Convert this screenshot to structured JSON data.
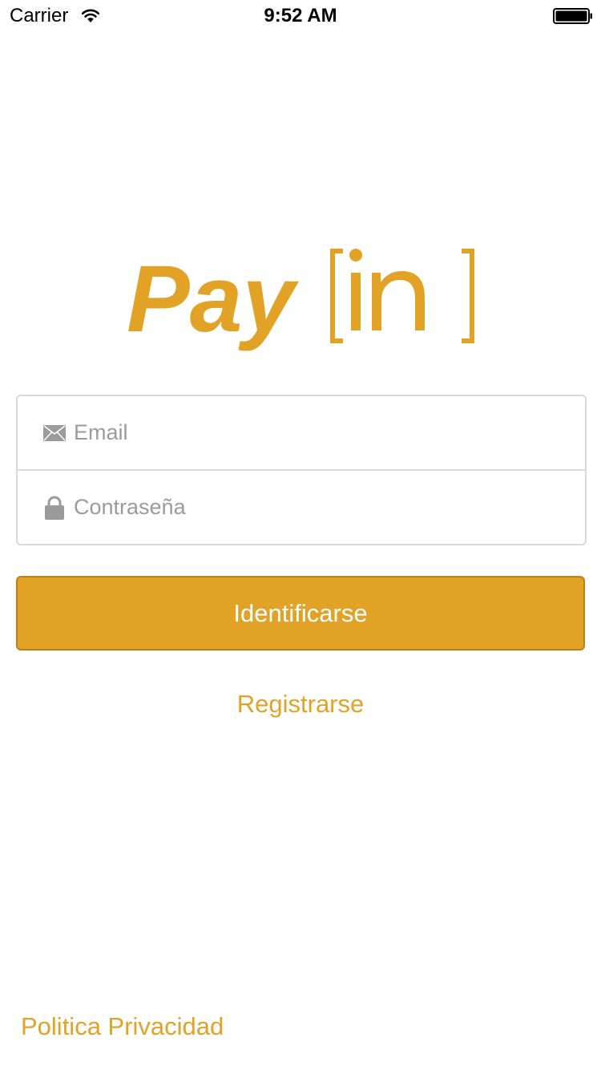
{
  "status_bar": {
    "carrier": "Carrier",
    "time": "9:52 AM"
  },
  "logo": {
    "text": "Pay[in]",
    "color": "#e2a226"
  },
  "login_form": {
    "email": {
      "placeholder": "Email",
      "value": "",
      "icon": "envelope-icon"
    },
    "password": {
      "placeholder": "Contraseña",
      "value": "",
      "icon": "lock-icon"
    }
  },
  "login_button": {
    "label": "Identificarse"
  },
  "register_link": {
    "label": "Registrarse"
  },
  "privacy_link": {
    "label": "Politica Privacidad"
  },
  "colors": {
    "accent": "#e2a226",
    "field_border": "#d9d9d9",
    "placeholder": "#9b9b9b"
  }
}
